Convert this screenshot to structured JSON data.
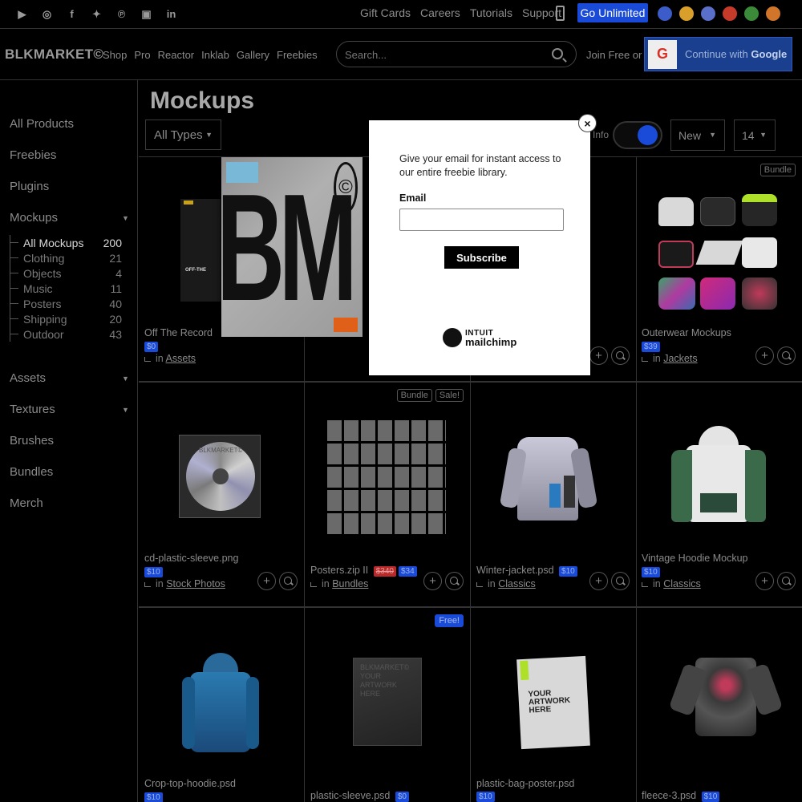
{
  "topbar": {
    "social_icons": [
      "youtube-icon",
      "instagram-icon",
      "facebook-icon",
      "twitter-icon",
      "pinterest-icon",
      "twitch-icon",
      "linkedin-icon"
    ],
    "links": [
      "Gift Cards",
      "Careers",
      "Tutorials",
      "Support"
    ],
    "unlimited_label": "Go Unlimited",
    "flags": [
      {
        "name": "us-flag-icon",
        "color": "#3c5cc9"
      },
      {
        "name": "es-flag-icon",
        "color": "#d8a02a"
      },
      {
        "name": "ru-flag-icon",
        "color": "#5a6fc9"
      },
      {
        "name": "cn-flag-icon",
        "color": "#c63a2a"
      },
      {
        "name": "pt-flag-icon",
        "color": "#3a8a3a"
      },
      {
        "name": "de-flag-icon",
        "color": "#d0752a"
      }
    ]
  },
  "nav": {
    "logo": "BLKMARKET©",
    "links": [
      "Shop",
      "Pro",
      "Reactor",
      "Inklab",
      "Gallery",
      "Freebies"
    ],
    "search_placeholder": "Search...",
    "join_label": "Join Free or",
    "google_label": "Continue with",
    "google_bold": "Google"
  },
  "sidebar": {
    "items": [
      "All Products",
      "Freebies",
      "Plugins",
      "Mockups",
      "Assets",
      "Textures",
      "Brushes",
      "Bundles",
      "Merch"
    ],
    "sub_items": [
      {
        "label": "All Mockups",
        "count": "200"
      },
      {
        "label": "Clothing",
        "count": "21"
      },
      {
        "label": "Objects",
        "count": "4"
      },
      {
        "label": "Music",
        "count": "11"
      },
      {
        "label": "Posters",
        "count": "40"
      },
      {
        "label": "Shipping",
        "count": "20"
      },
      {
        "label": "Outdoor",
        "count": "43"
      }
    ]
  },
  "main": {
    "title": "Mockups",
    "type_filter": "All Types",
    "info_label": "Info",
    "sort_value": "New",
    "count_value": "14"
  },
  "cards": [
    {
      "title": "Off The Record",
      "price": "$0",
      "category": "Assets"
    },
    {
      "title": "Outerwear Mockups",
      "price": "$39",
      "category": "Jackets",
      "badge": "Bundle"
    },
    {
      "title": "cd-plastic-sleeve.png",
      "price": "$10",
      "category": "Stock Photos"
    },
    {
      "title": "Posters.zip II",
      "old_price": "$340",
      "price": "$34",
      "category": "Bundles",
      "badges": [
        "Bundle",
        "Sale!"
      ]
    },
    {
      "title": "Winter-jacket.psd",
      "price": "$10",
      "category": "Classics"
    },
    {
      "title": "Vintage Hoodie Mockup",
      "price": "$10",
      "category": "Classics"
    },
    {
      "title": "Crop-top-hoodie.psd",
      "price": "$10"
    },
    {
      "title": "plastic-sleeve.psd",
      "price": "$0",
      "badge": "Free!"
    },
    {
      "title": "plastic-bag-poster.psd",
      "price": "$10"
    },
    {
      "title": "fleece-3.psd",
      "price": "$10"
    }
  ],
  "common": {
    "in_label": "in"
  },
  "modal": {
    "text": "Give your email for instant access to our entire freebie library.",
    "email_label": "Email",
    "subscribe_label": "Subscribe",
    "brand_top": "INTUIT",
    "brand_bottom": "mailchimp",
    "close_label": "×"
  },
  "art": {
    "bm": "BM",
    "copyright": "©",
    "cd_text": "BLKMARKET©",
    "sleeve_text": "BLKMARKET© YOUR ARTWORK HERE",
    "bag_text": "YOUR ARTWORK HERE",
    "record_label": "OFF-THE"
  }
}
